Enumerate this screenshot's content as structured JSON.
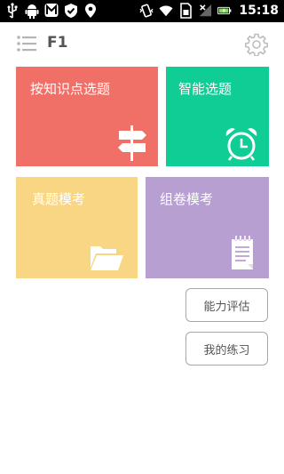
{
  "status_bar": {
    "time": "15:18",
    "icons": [
      "usb-icon",
      "android-debug-icon",
      "maps-m-icon",
      "shield-icon",
      "location-pin-icon",
      "vibrate-icon",
      "wifi-icon",
      "sim-icon",
      "no-signal-icon",
      "battery-charging-icon"
    ]
  },
  "header": {
    "title": "F1",
    "menu_icon": "list-menu-icon",
    "settings_icon": "gear-icon"
  },
  "tiles": [
    {
      "label": "按知识点选题",
      "color": "#f07068",
      "icon": "signpost-icon"
    },
    {
      "label": "智能选题",
      "color": "#10cc95",
      "icon": "alarm-clock-icon"
    },
    {
      "label": "真题模考",
      "color": "#f9d683",
      "icon": "folder-icon"
    },
    {
      "label": "组卷模考",
      "color": "#b79fd1",
      "icon": "notepad-icon"
    }
  ],
  "buttons": [
    {
      "label": "能力评估"
    },
    {
      "label": "我的练习"
    }
  ]
}
